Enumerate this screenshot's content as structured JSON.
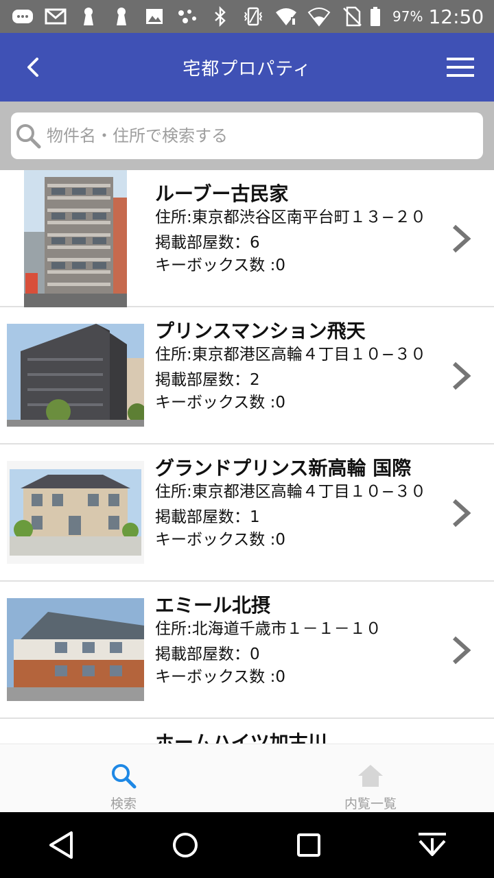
{
  "status_bar": {
    "battery": "97%",
    "time": "12:50",
    "icons": [
      "message-icon",
      "gmail-icon",
      "keyhole-icon",
      "keyhole-icon",
      "image-icon",
      "dots-icon",
      "bluetooth-icon",
      "vibrate-icon",
      "wifi-icon",
      "wifi-icon",
      "no-sim-icon",
      "battery-icon"
    ]
  },
  "app_bar": {
    "title": "宅都プロパティ"
  },
  "search": {
    "placeholder": "物件名・住所で検索する"
  },
  "properties": [
    {
      "name": "ルーブー古民家",
      "address": "住所:東京都渋谷区南平台町１３−２０",
      "rooms": "掲載部屋数：6",
      "keyboxes": "キーボックス数 :0"
    },
    {
      "name": "プリンスマンション飛天",
      "address": "住所:東京都港区高輪４丁目１０−３０",
      "rooms": "掲載部屋数：2",
      "keyboxes": "キーボックス数 :0"
    },
    {
      "name": "グランドプリンス新高輪 国際",
      "address": "住所:東京都港区高輪４丁目１０−３０",
      "rooms": "掲載部屋数：1",
      "keyboxes": "キーボックス数 :0"
    },
    {
      "name": "エミール北摂",
      "address": "住所:北海道千歳市１－１－１０",
      "rooms": "掲載部屋数：0",
      "keyboxes": "キーボックス数 :0"
    },
    {
      "name": "ホームハイツ加古川",
      "address": "",
      "rooms": "",
      "keyboxes": ""
    }
  ],
  "bottom_nav": [
    {
      "label": "検索",
      "icon": "search-icon",
      "active": true,
      "color": "#1e88e5"
    },
    {
      "label": "内覧一覧",
      "icon": "home-icon",
      "active": false,
      "color": "#bdbdbd"
    }
  ],
  "colors": {
    "app_bar": "#3f51b5",
    "search_bg": "#bdbdbd",
    "status_bar": "#6e6e6e"
  }
}
